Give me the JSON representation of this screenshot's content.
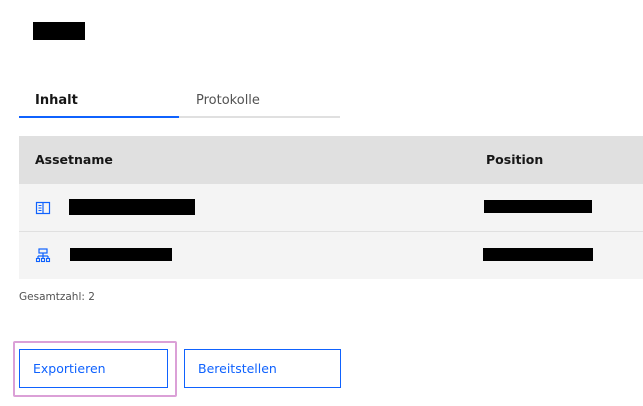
{
  "page": {
    "title_redacted": true
  },
  "tabs": [
    {
      "label": "Inhalt",
      "active": true
    },
    {
      "label": "Protokolle",
      "active": false
    }
  ],
  "table": {
    "columns": [
      "Assetname",
      "Position"
    ],
    "rows": [
      {
        "icon": "book-icon",
        "name_redacted": true,
        "position_redacted": true
      },
      {
        "icon": "hierarchy-icon",
        "name_redacted": true,
        "position_redacted": true
      }
    ]
  },
  "footer": {
    "total_count": "Gesamtzahl: 2"
  },
  "actions": {
    "export_label": "Exportieren",
    "provide_label": "Bereitstellen"
  },
  "colors": {
    "accent": "#0f62fe",
    "header_bg": "#e0e0e0",
    "row_bg": "#f4f4f4",
    "focus": "#dba0d7"
  }
}
